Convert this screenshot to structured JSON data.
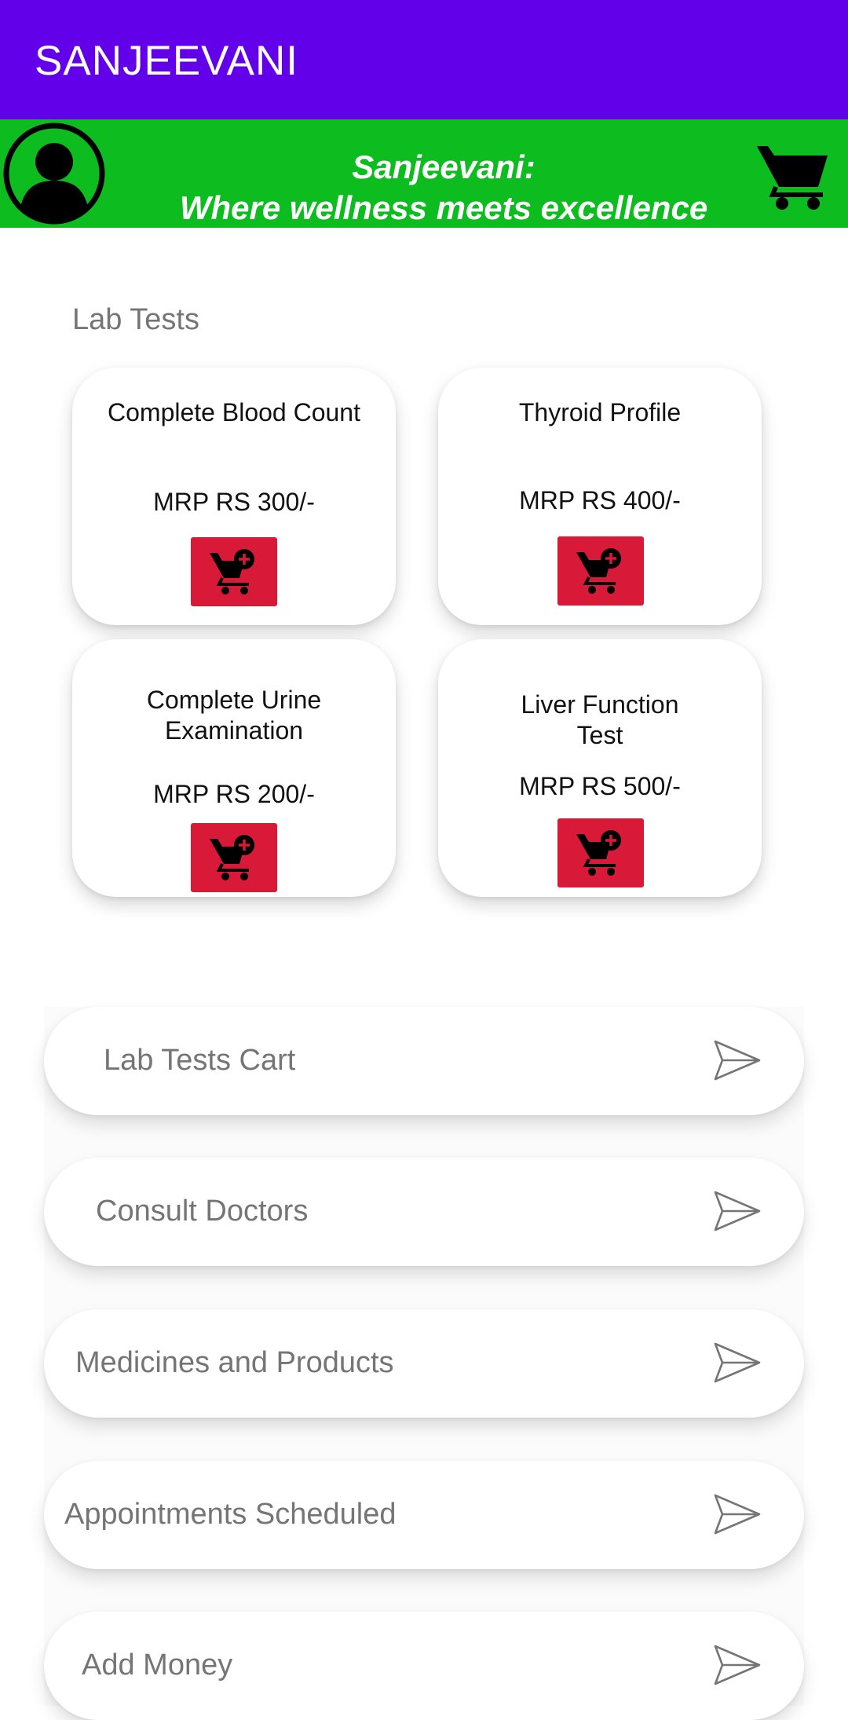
{
  "app_bar": {
    "title": "SANJEEVANI"
  },
  "banner": {
    "tagline_line1": "Sanjeevani:",
    "tagline_line2": "Where wellness meets excellence",
    "profile_icon": "account-circle-icon",
    "cart_icon": "shopping-cart-icon"
  },
  "lab_tests": {
    "section_label": "Lab Tests",
    "add_icon": "add-shopping-cart-icon",
    "tests": [
      {
        "name": "Complete Blood Count",
        "price": "MRP RS 300/-"
      },
      {
        "name": "Thyroid Profile",
        "price": "MRP RS 400/-"
      },
      {
        "name": "Complete Urine Examination",
        "price": "MRP RS 200/-"
      },
      {
        "name": "Liver Function Test",
        "price": "MRP RS 500/-"
      }
    ]
  },
  "nav_items": [
    {
      "label": "Lab Tests Cart",
      "icon": "send-icon"
    },
    {
      "label": "Consult Doctors",
      "icon": "send-icon"
    },
    {
      "label": "Medicines and Products",
      "icon": "send-icon"
    },
    {
      "label": "Appointments Scheduled",
      "icon": "send-icon"
    },
    {
      "label": "Add Money",
      "icon": "send-icon"
    }
  ],
  "colors": {
    "app_bar": "#6200ea",
    "banner": "#0dbc1e",
    "add_button": "#d81a38",
    "muted_text": "#757575"
  }
}
